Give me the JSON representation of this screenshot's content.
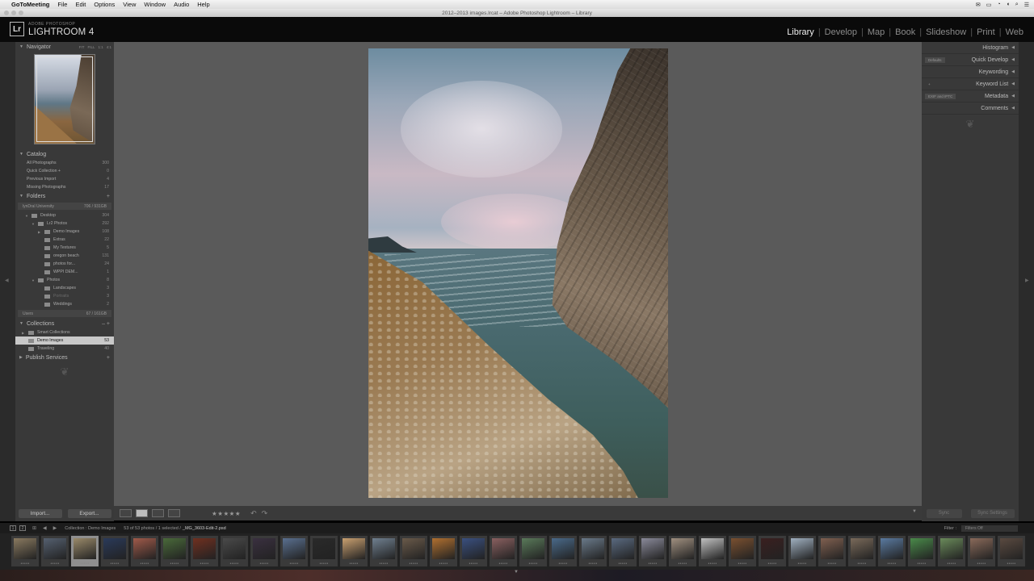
{
  "menubar": {
    "app": "GoToMeeting",
    "items": [
      "File",
      "Edit",
      "Options",
      "View",
      "Window",
      "Audio",
      "Help"
    ],
    "status_icons": [
      "envelope-icon",
      "tv-icon",
      "wifi-icon",
      "volume-icon",
      "search-icon"
    ]
  },
  "window": {
    "title": "2012–2013 images.lrcat – Adobe Photoshop Lightroom – Library"
  },
  "identity": {
    "sub": "ADOBE PHOTOSHOP",
    "name": "LIGHTROOM 4",
    "logo": "Lr"
  },
  "modules": [
    {
      "label": "Library",
      "active": true
    },
    {
      "label": "Develop",
      "active": false
    },
    {
      "label": "Map",
      "active": false
    },
    {
      "label": "Book",
      "active": false
    },
    {
      "label": "Slideshow",
      "active": false
    },
    {
      "label": "Print",
      "active": false
    },
    {
      "label": "Web",
      "active": false
    }
  ],
  "left": {
    "navigator": {
      "title": "Navigator",
      "options": [
        "FIT",
        "FILL",
        "1:1",
        "4:1"
      ]
    },
    "catalog": {
      "title": "Catalog",
      "items": [
        {
          "label": "All Photographs",
          "count": "300"
        },
        {
          "label": "Quick Collection +",
          "count": "0"
        },
        {
          "label": "Previous Import",
          "count": "4"
        },
        {
          "label": "Missing Photographs",
          "count": "17"
        }
      ]
    },
    "folders": {
      "title": "Folders",
      "volume": {
        "label": "lynDral University",
        "count": "706 / 931GB"
      },
      "items": [
        {
          "label": "Desktop",
          "count": "304",
          "indent": 1,
          "caret": "▼"
        },
        {
          "label": "Lr2 Photos",
          "count": "292",
          "indent": 2,
          "caret": "▼"
        },
        {
          "label": "Demo Images",
          "count": "108",
          "indent": 3,
          "caret": "▶"
        },
        {
          "label": "Extras",
          "count": "22",
          "indent": 3,
          "caret": ""
        },
        {
          "label": "My Textures",
          "count": "5",
          "indent": 3,
          "caret": ""
        },
        {
          "label": "oregon beach",
          "count": "131",
          "indent": 3,
          "caret": ""
        },
        {
          "label": "photos for...",
          "count": "24",
          "indent": 3,
          "caret": ""
        },
        {
          "label": "WPPI DEM...",
          "count": "1",
          "indent": 3,
          "caret": ""
        },
        {
          "label": "Photos",
          "count": "8",
          "indent": 2,
          "caret": "▼"
        },
        {
          "label": "Landscapes",
          "count": "3",
          "indent": 3,
          "caret": ""
        },
        {
          "label": "Portraits",
          "count": "3",
          "indent": 3,
          "caret": "",
          "dim": true
        },
        {
          "label": "Weddings",
          "count": "2",
          "indent": 3,
          "caret": ""
        }
      ],
      "volume2": {
        "label": "Users",
        "count": "67 / 161GB"
      }
    },
    "collections": {
      "title": "Collections",
      "items": [
        {
          "label": "Smart Collections",
          "count": "",
          "caret": "▶",
          "selected": false
        },
        {
          "label": "Demo Images",
          "count": "53",
          "caret": "",
          "selected": true
        },
        {
          "label": "Traveling",
          "count": "40",
          "caret": "",
          "selected": false
        }
      ]
    },
    "publish": {
      "title": "Publish Services"
    },
    "import_label": "Import...",
    "export_label": "Export..."
  },
  "right": {
    "panels": [
      {
        "label": "Histogram",
        "chip": ""
      },
      {
        "label": "Quick Develop",
        "chip": "Defaults"
      },
      {
        "label": "Keywording",
        "chip": ""
      },
      {
        "label": "Keyword List",
        "chip": "+"
      },
      {
        "label": "Metadata",
        "chip": "EXIF and IPTC"
      },
      {
        "label": "Comments",
        "chip": ""
      }
    ],
    "sync_label": "Sync",
    "sync_settings_label": "Sync Settings"
  },
  "toolbar": {
    "stars": "★★★★★",
    "rotate_left": "↶",
    "rotate_right": "↷",
    "menu": "▼"
  },
  "filmstrip": {
    "screen1": "1",
    "screen2": "2",
    "collection": "Collection : Demo Images",
    "status": "53 of 53 photos / 1 selected /",
    "filename": "_MG_3603-Edit-2.psd",
    "filter_label": "Filter :",
    "filter_value": "Filters Off",
    "selected_index": 2,
    "thumb_colors": [
      "#8a7a60",
      "#556070",
      "#9a8a6a",
      "#2a3a5a",
      "#a05a4a",
      "#4a6a3a",
      "#703020",
      "#4a4a4a",
      "#3a3040",
      "#5a7090",
      "#2a2a2a",
      "#c9a070",
      "#708090",
      "#6a5a4a",
      "#b07030",
      "#3a5080",
      "#8a6060",
      "#5a7a5a",
      "#4a6a8a",
      "#6a7a8a",
      "#5a6a80",
      "#8a8a9a",
      "#a09080",
      "#c0c0c0",
      "#7a5030",
      "#3a2020",
      "#a0b0c0",
      "#806050",
      "#7a6a5a",
      "#5a7aa0",
      "#4a8a4a",
      "#6a8a5a",
      "#8a6a5a",
      "#5a4a40"
    ]
  }
}
